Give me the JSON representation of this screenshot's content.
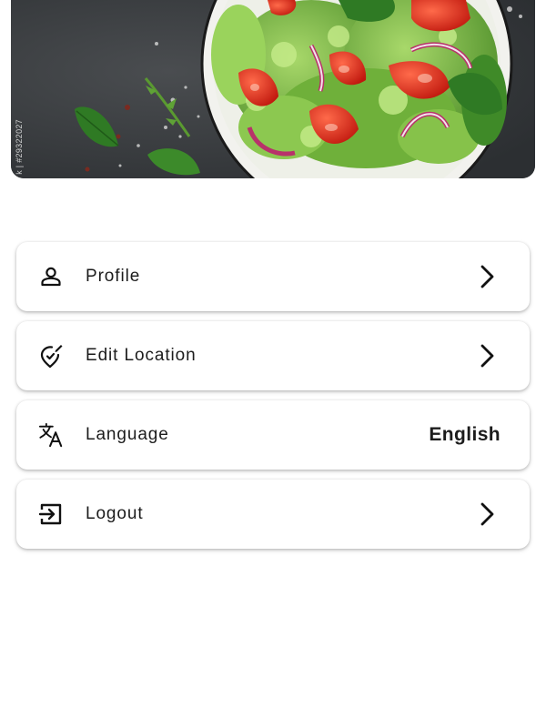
{
  "banner": {
    "watermark": "k | #29322027"
  },
  "menu": {
    "items": [
      {
        "key": "profile",
        "label": "Profile",
        "icon": "person-icon",
        "trailing": "chevron-right-icon"
      },
      {
        "key": "edit-location",
        "label": "Edit Location",
        "icon": "location-edit-icon",
        "trailing": "chevron-right-icon"
      },
      {
        "key": "language",
        "label": "Language",
        "icon": "translate-icon",
        "value": "English"
      },
      {
        "key": "logout",
        "label": "Logout",
        "icon": "logout-icon",
        "trailing": "chevron-right-icon"
      }
    ]
  }
}
